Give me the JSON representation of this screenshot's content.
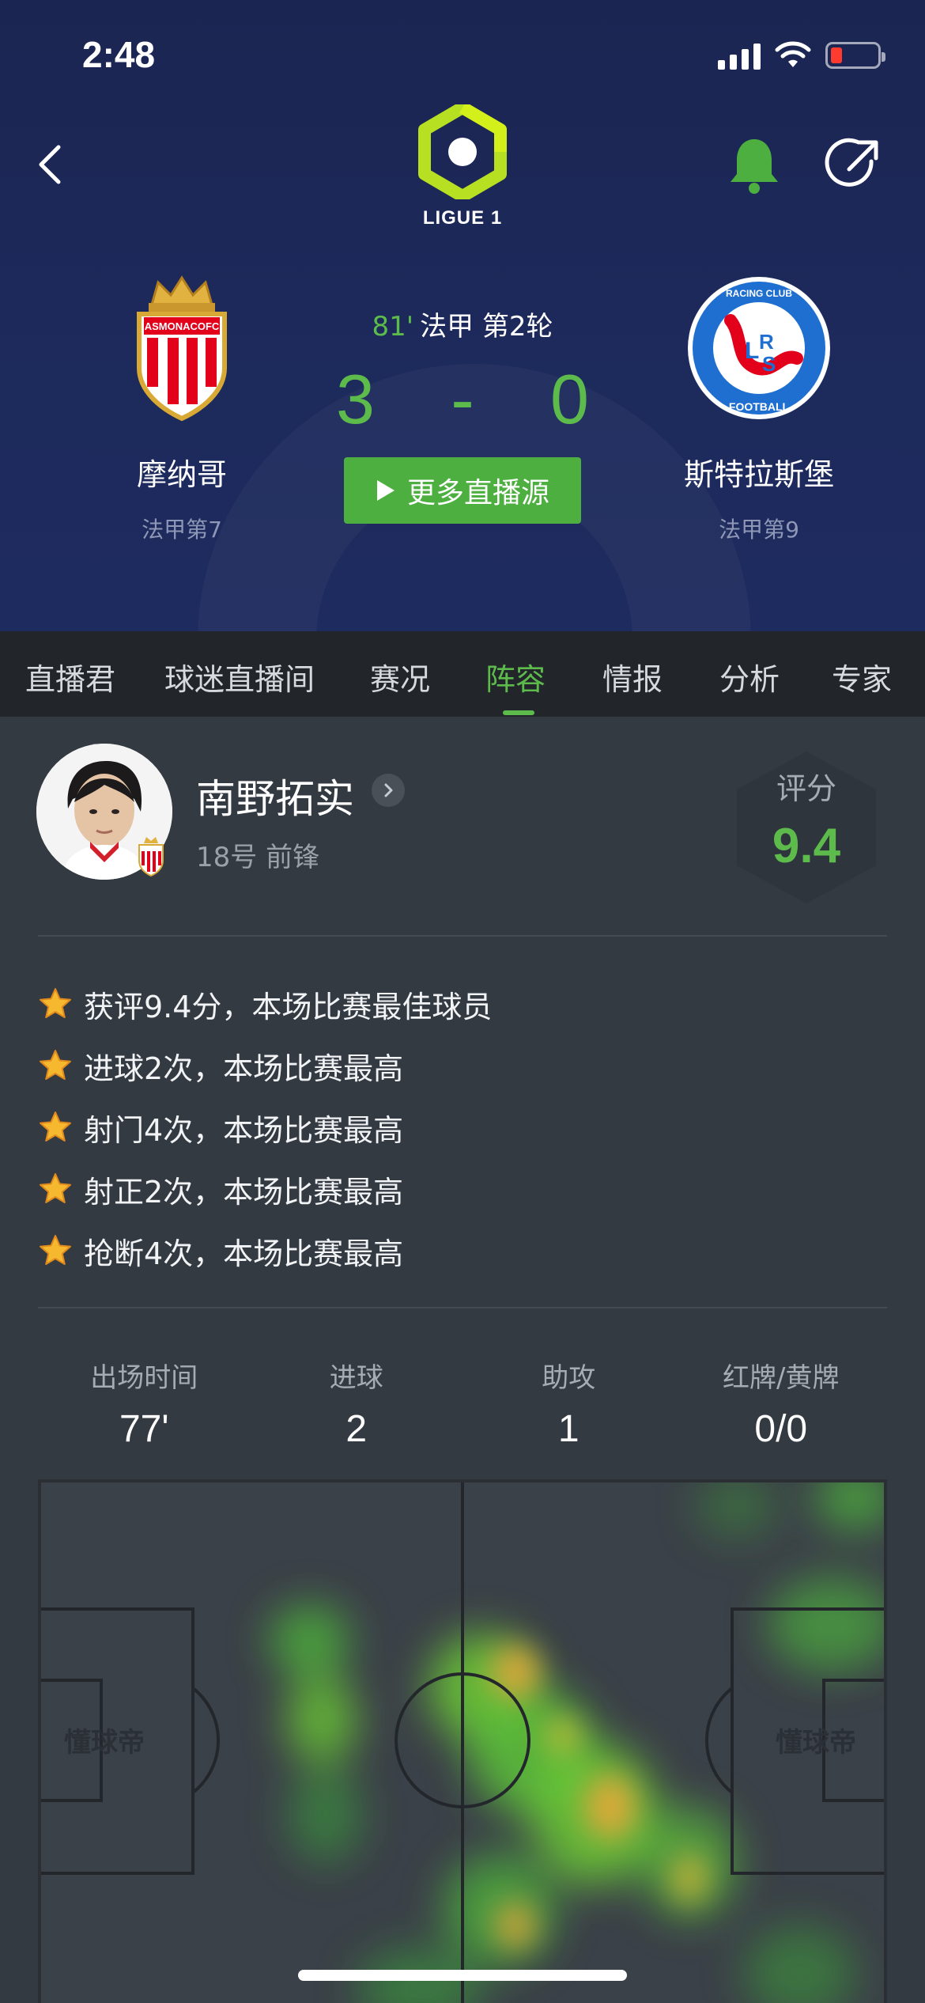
{
  "status": {
    "time": "2:48"
  },
  "league": {
    "name": "LIGUE 1"
  },
  "match": {
    "minute": "81'",
    "round": "法甲 第2轮",
    "home": {
      "name": "摩纳哥",
      "rank": "法甲第7",
      "crest_text": "ASMONACOFC"
    },
    "away": {
      "name": "斯特拉斯堡",
      "rank": "法甲第9",
      "crest_text": "RACING CLUB DE STRASBOURG",
      "crest_sub": "FOOTBALL"
    },
    "score_home": "3",
    "score_sep": "-",
    "score_away": "0",
    "live_button": "更多直播源"
  },
  "tabs": [
    {
      "label": "直播君"
    },
    {
      "label": "球迷直播间"
    },
    {
      "label": "赛况"
    },
    {
      "label": "阵容"
    },
    {
      "label": "情报"
    },
    {
      "label": "分析"
    },
    {
      "label": "专家"
    }
  ],
  "active_tab": "阵容",
  "player": {
    "name": "南野拓实",
    "info": "18号 前锋",
    "rating_label": "评分",
    "rating": "9.4"
  },
  "highlights": [
    "获评9.4分，本场比赛最佳球员",
    "进球2次，本场比赛最高",
    "射门4次，本场比赛最高",
    "射正2次，本场比赛最高",
    "抢断4次，本场比赛最高"
  ],
  "stats": [
    {
      "label": "出场时间",
      "value": "77'"
    },
    {
      "label": "进球",
      "value": "2"
    },
    {
      "label": "助攻",
      "value": "1"
    },
    {
      "label": "红牌/黄牌",
      "value": "0/0"
    }
  ],
  "heatmap": {
    "watermark": "懂球帝"
  },
  "colors": {
    "accent": "#5dbb4c",
    "header_bg": "#1d2a5c",
    "tabs_bg": "#22262b",
    "content_bg": "#343a42",
    "star": "#f5b82e"
  }
}
